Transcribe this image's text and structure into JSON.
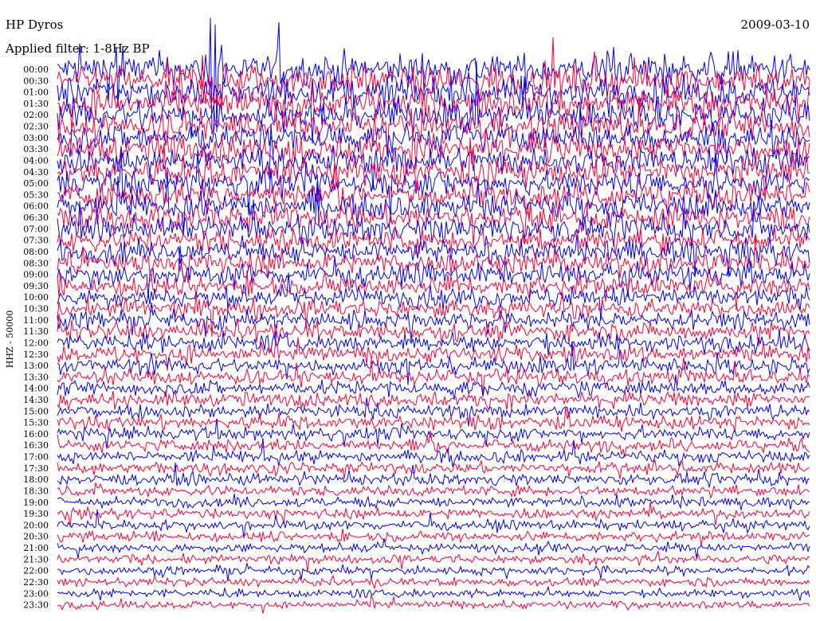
{
  "header": {
    "station": "HP Dyros",
    "filter": "Applied filter: 1-8Hz BP",
    "date": "2009-03-10"
  },
  "chart_data": {
    "type": "line",
    "title": "HP Dyros",
    "date": "2009-03-10",
    "filter": "Applied filter: 1-8Hz BP",
    "ylabel": "HHZ - 50000",
    "row_labels": [
      "00:00",
      "00:30",
      "01:00",
      "01:30",
      "02:00",
      "02:30",
      "03:00",
      "03:30",
      "04:00",
      "04:30",
      "05:00",
      "05:30",
      "06:00",
      "06:30",
      "07:00",
      "07:30",
      "08:00",
      "08:30",
      "09:00",
      "09:30",
      "10:00",
      "10:30",
      "11:00",
      "11:30",
      "12:00",
      "12:30",
      "13:00",
      "13:30",
      "14:00",
      "14:30",
      "15:00",
      "15:30",
      "16:00",
      "16:30",
      "17:00",
      "17:30",
      "18:00",
      "18:30",
      "19:00",
      "19:30",
      "20:00",
      "20:30",
      "21:00",
      "21:30",
      "22:00",
      "22:30",
      "23:00",
      "23:30"
    ],
    "trace_colors": [
      "#0000ff",
      "#ff0033"
    ],
    "amplitude_profile": [
      [
        0,
        5.5
      ],
      [
        6,
        4.5
      ],
      [
        10,
        3.4
      ],
      [
        14,
        2.6
      ],
      [
        18,
        1.9
      ],
      [
        22,
        1.5
      ],
      [
        23.5,
        1.4
      ]
    ],
    "events": [
      {
        "row": "00:00",
        "x_fraction": 0.08,
        "strength": 4
      },
      {
        "row": "00:00",
        "x_fraction": 0.21,
        "strength": 6
      },
      {
        "row": "00:30",
        "x_fraction": 0.21,
        "strength": 5
      }
    ]
  }
}
